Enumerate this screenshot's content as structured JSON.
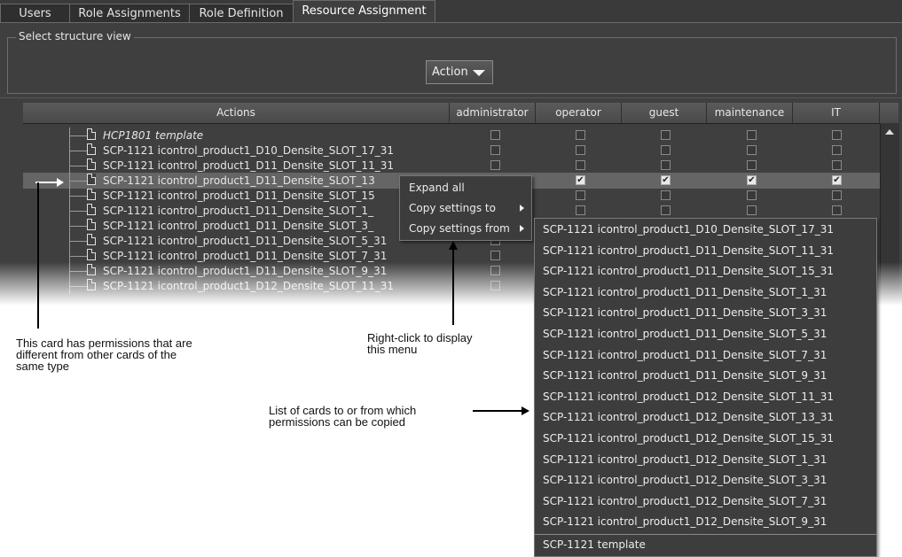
{
  "tabs": [
    {
      "label": "Users",
      "active": false
    },
    {
      "label": "Role Assignments",
      "active": false
    },
    {
      "label": "Role Definition",
      "active": false
    },
    {
      "label": "Resource Assignment",
      "active": true
    }
  ],
  "structure_view": {
    "label": "Select structure view",
    "value": "Action"
  },
  "table": {
    "columns": [
      "Actions",
      "administrator",
      "operator",
      "guest",
      "maintenance",
      "IT"
    ],
    "rows": [
      {
        "label": "HCP1801 template",
        "italic": true,
        "checks": [
          false,
          false,
          false,
          false,
          false
        ]
      },
      {
        "label": "SCP-1121 icontrol_product1_D10_Densite_SLOT_17_31",
        "checks": [
          false,
          false,
          false,
          false,
          false
        ]
      },
      {
        "label": "SCP-1121 icontrol_product1_D11_Densite_SLOT_11_31",
        "checks": [
          false,
          false,
          false,
          false,
          false
        ]
      },
      {
        "label": "SCP-1121 icontrol_product1_D11_Densite_SLOT_13",
        "selected": true,
        "checks": [
          false,
          true,
          true,
          true,
          true
        ]
      },
      {
        "label": "SCP-1121 icontrol_product1_D11_Densite_SLOT_15",
        "checks": [
          false,
          false,
          false,
          false,
          false
        ]
      },
      {
        "label": "SCP-1121 icontrol_product1_D11_Densite_SLOT_1_",
        "checks": [
          false,
          false,
          false,
          false,
          false
        ]
      },
      {
        "label": "SCP-1121 icontrol_product1_D11_Densite_SLOT_3_",
        "checks": [
          false,
          false,
          false,
          false,
          false
        ]
      },
      {
        "label": "SCP-1121 icontrol_product1_D11_Densite_SLOT_5_31",
        "checks": [
          false,
          false,
          false,
          false,
          false
        ]
      },
      {
        "label": "SCP-1121 icontrol_product1_D11_Densite_SLOT_7_31",
        "checks": [
          false,
          false,
          false,
          false,
          false
        ]
      },
      {
        "label": "SCP-1121 icontrol_product1_D11_Densite_SLOT_9_31",
        "checks": [
          false,
          false,
          false,
          false,
          false
        ]
      },
      {
        "label": "SCP-1121 icontrol_product1_D12_Densite_SLOT_11_31",
        "checks": [
          false,
          false,
          false,
          false,
          false
        ]
      }
    ]
  },
  "context_menu": {
    "items": [
      {
        "label": "Expand all",
        "submenu": false
      },
      {
        "label": "Copy settings to",
        "submenu": true
      },
      {
        "label": "Copy settings from",
        "submenu": true
      }
    ]
  },
  "submenu": {
    "items": [
      "SCP-1121 icontrol_product1_D10_Densite_SLOT_17_31",
      "SCP-1121 icontrol_product1_D11_Densite_SLOT_11_31",
      "SCP-1121 icontrol_product1_D11_Densite_SLOT_15_31",
      "SCP-1121 icontrol_product1_D11_Densite_SLOT_1_31",
      "SCP-1121 icontrol_product1_D11_Densite_SLOT_3_31",
      "SCP-1121 icontrol_product1_D11_Densite_SLOT_5_31",
      "SCP-1121 icontrol_product1_D11_Densite_SLOT_7_31",
      "SCP-1121 icontrol_product1_D11_Densite_SLOT_9_31",
      "SCP-1121 icontrol_product1_D12_Densite_SLOT_11_31",
      "SCP-1121 icontrol_product1_D12_Densite_SLOT_13_31",
      "SCP-1121 icontrol_product1_D12_Densite_SLOT_15_31",
      "SCP-1121 icontrol_product1_D12_Densite_SLOT_1_31",
      "SCP-1121 icontrol_product1_D12_Densite_SLOT_3_31",
      "SCP-1121 icontrol_product1_D12_Densite_SLOT_7_31",
      "SCP-1121 icontrol_product1_D12_Densite_SLOT_9_31"
    ],
    "footer": "SCP-1121 template"
  },
  "annotations": {
    "card_permissions": [
      "This card has permissions that are",
      "different from other cards of the",
      "same type"
    ],
    "right_click": [
      "Right-click to display",
      "this menu"
    ],
    "list_of_cards": [
      "List of cards to or from which",
      "permissions can be copied"
    ]
  }
}
